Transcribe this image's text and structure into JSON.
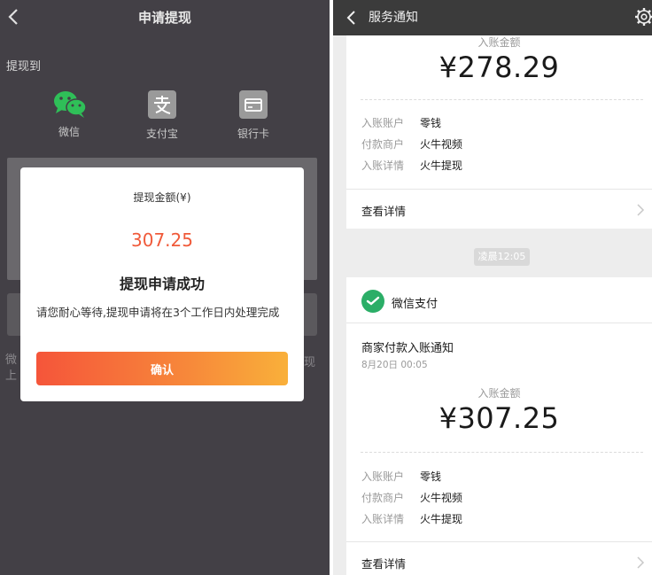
{
  "left": {
    "nav_title": "申请提现",
    "withdraw_to_label": "提现到",
    "methods": [
      {
        "label": "微信",
        "icon": "wechat-icon"
      },
      {
        "label": "支付宝",
        "icon": "alipay-icon"
      },
      {
        "label": "银行卡",
        "icon": "bank-card-icon"
      }
    ],
    "behind_text_left": "微\n上",
    "behind_text_right": "现",
    "dialog": {
      "amount_label": "提现金额(¥)",
      "amount": "307.25",
      "title": "提现申请成功",
      "message": "请您耐心等待,提现申请将在3个工作日内处理完成",
      "confirm_label": "确认"
    },
    "colors": {
      "background": "#434046",
      "accent": "#f05a3a"
    }
  },
  "right": {
    "nav_title": "服务通知",
    "card1": {
      "amount_label": "入账金额",
      "amount": "¥278.29",
      "rows": [
        {
          "key": "入账账户",
          "value": "零钱"
        },
        {
          "key": "付款商户",
          "value": "火牛视频"
        },
        {
          "key": "入账详情",
          "value": "火牛提现"
        }
      ],
      "detail_label": "查看详情"
    },
    "time_pill": "凌晨12:05",
    "card2": {
      "pay_name": "微信支付",
      "notice_title": "商家付款入账通知",
      "notice_date": "8月20日  00:05",
      "amount_label": "入账金额",
      "amount": "¥307.25",
      "rows": [
        {
          "key": "入账账户",
          "value": "零钱"
        },
        {
          "key": "付款商户",
          "value": "火牛视频"
        },
        {
          "key": "入账详情",
          "value": "火牛提现"
        }
      ],
      "detail_label": "查看详情"
    },
    "colors": {
      "nav": "#3b3b3b",
      "wechat_green": "#2bae67",
      "background": "#ededed"
    }
  }
}
